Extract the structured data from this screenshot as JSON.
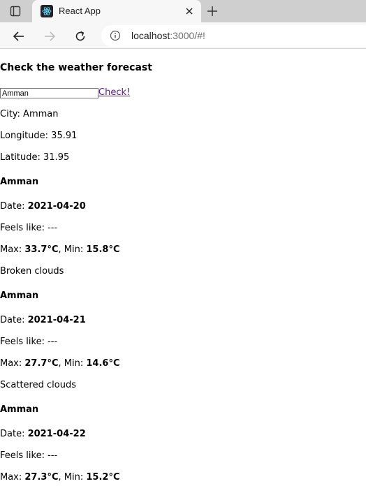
{
  "browser": {
    "tab_title": "React App",
    "url_host": "localhost",
    "url_rest": ":3000/#!"
  },
  "app": {
    "heading": "Check the weather forecast",
    "search_value": "Amman",
    "check_label": "Check!",
    "city_line": "City: Amman",
    "longitude_line": "Longitude: 35.91",
    "latitude_line": "Latitude: 31.95"
  },
  "labels": {
    "date": "Date: ",
    "feels_like": "Feels like: ---",
    "max": "Max: ",
    "min_sep": ", Min: "
  },
  "forecasts": [
    {
      "city": "Amman",
      "date": "2021-04-20",
      "max": "33.7°C",
      "min": "15.8°C",
      "description": "Broken clouds"
    },
    {
      "city": "Amman",
      "date": "2021-04-21",
      "max": "27.7°C",
      "min": "14.6°C",
      "description": "Scattered clouds"
    },
    {
      "city": "Amman",
      "date": "2021-04-22",
      "max": "27.3°C",
      "min": "15.2°C"
    }
  ]
}
